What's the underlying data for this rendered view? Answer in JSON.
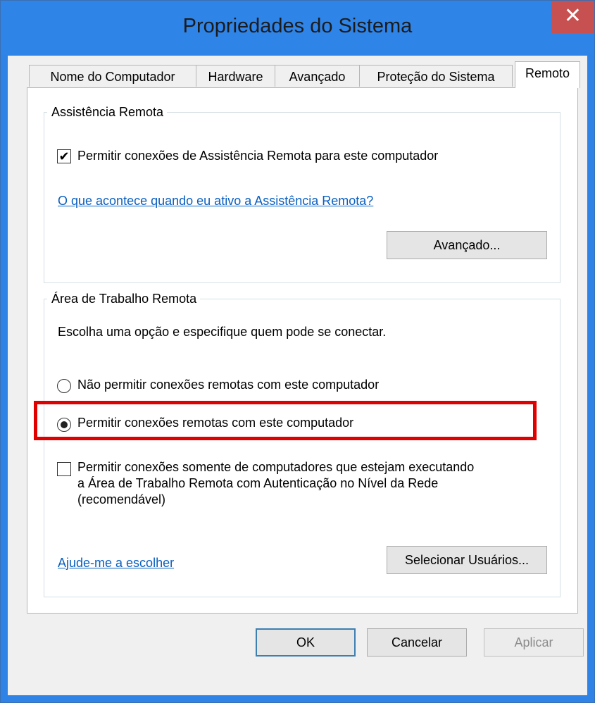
{
  "window": {
    "title": "Propriedades do Sistema",
    "close_glyph": "✕"
  },
  "tabs": [
    {
      "label": "Nome do Computador"
    },
    {
      "label": "Hardware"
    },
    {
      "label": "Avançado"
    },
    {
      "label": "Proteção do Sistema"
    },
    {
      "label": "Remoto"
    }
  ],
  "active_tab": "Remoto",
  "remote_assistance": {
    "legend": "Assistência Remota",
    "allow_label": "Permitir conexões de Assistência Remota para este computador",
    "allow_checked": true,
    "check_glyph": "✔",
    "help_link": "O que acontece quando eu ativo a Assistência Remota?",
    "advanced_button": "Avançado..."
  },
  "remote_desktop": {
    "legend": "Área de Trabalho Remota",
    "instruction": "Escolha uma opção e especifique quem pode se conectar.",
    "option_deny": "Não permitir conexões remotas com este computador",
    "option_allow": "Permitir conexões remotas com este computador",
    "selected_option": "option_allow",
    "nla_label_line1": "Permitir conexões somente de computadores que estejam executando",
    "nla_label_line2": "a Área de Trabalho Remota com Autenticação no Nível da Rede",
    "nla_label_line3": "(recomendável)",
    "nla_checked": false,
    "help_link": "Ajude-me a escolher",
    "select_users_button": "Selecionar Usuários..."
  },
  "footer": {
    "ok": "OK",
    "cancel": "Cancelar",
    "apply": "Aplicar"
  },
  "colors": {
    "titlebar": "#2f84e8",
    "close": "#c75050",
    "link": "#0a5fbf",
    "highlight": "#e00000"
  }
}
